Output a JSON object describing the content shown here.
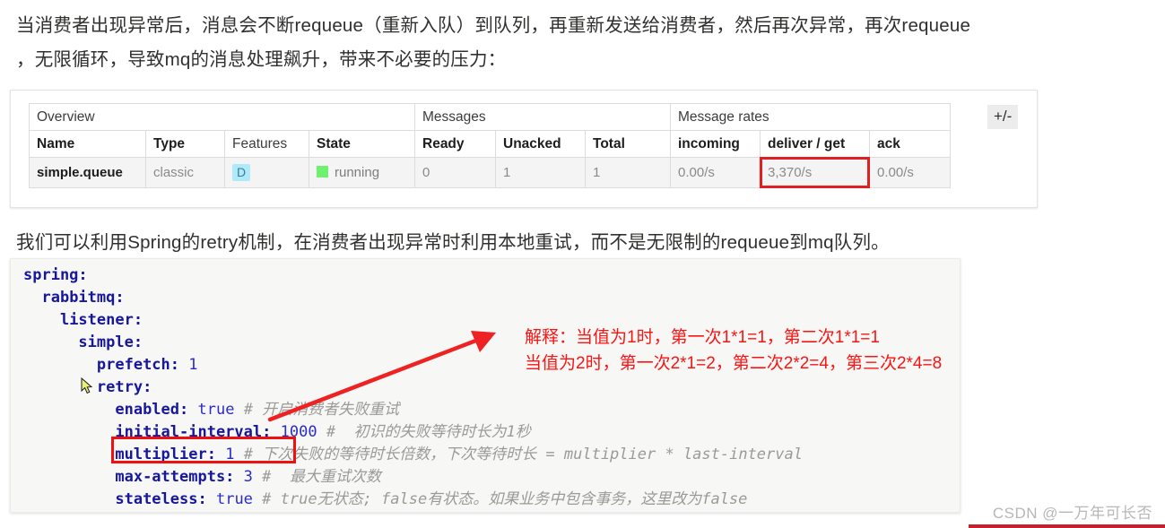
{
  "paragraphs": {
    "intro_line1": "当消费者出现异常后，消息会不断requeue（重新入队）到队列，再重新发送给消费者，然后再次异常，再次requeue",
    "intro_line2": "，无限循环，导致mq的消息处理飙升，带来不必要的压力：",
    "solution": "我们可以利用Spring的retry机制，在消费者出现异常时利用本地重试，而不是无限制的requeue到mq队列。"
  },
  "mq_table": {
    "group_headers": [
      "Overview",
      "Messages",
      "Message rates"
    ],
    "columns": [
      "Name",
      "Type",
      "Features",
      "State",
      "Ready",
      "Unacked",
      "Total",
      "incoming",
      "deliver / get",
      "ack"
    ],
    "rows": [
      {
        "name": "simple.queue",
        "type": "classic",
        "features": "D",
        "state": "running",
        "ready": "0",
        "unacked": "1",
        "total": "1",
        "incoming": "0.00/s",
        "deliver_get": "3,370/s",
        "ack": "0.00/s"
      }
    ],
    "toggle_label": "+/-",
    "highlight_color": "#e02020",
    "state_dot_color": "#6ff06f",
    "feature_badge_color": "#aeeafb"
  },
  "code": {
    "lines": [
      {
        "indent": 0,
        "key": "spring:",
        "value": "",
        "comment": ""
      },
      {
        "indent": 1,
        "key": "rabbitmq:",
        "value": "",
        "comment": ""
      },
      {
        "indent": 2,
        "key": "listener:",
        "value": "",
        "comment": ""
      },
      {
        "indent": 3,
        "key": "simple:",
        "value": "",
        "comment": ""
      },
      {
        "indent": 4,
        "key": "prefetch:",
        "value": "1",
        "comment": ""
      },
      {
        "indent": 4,
        "key": "retry:",
        "value": "",
        "comment": ""
      },
      {
        "indent": 5,
        "key": "enabled:",
        "value": "true",
        "comment": "# 开启消费者失败重试"
      },
      {
        "indent": 5,
        "key": "initial-interval:",
        "value": "1000",
        "comment": "#  初识的失败等待时长为1秒"
      },
      {
        "indent": 5,
        "key": "multiplier:",
        "value": "1",
        "comment": "# 下次失败的等待时长倍数，下次等待时长 = multiplier * last-interval"
      },
      {
        "indent": 5,
        "key": "max-attempts:",
        "value": "3",
        "comment": "#  最大重试次数"
      },
      {
        "indent": 5,
        "key": "stateless:",
        "value": "true",
        "comment": "# true无状态; false有状态。如果业务中包含事务，这里改为false"
      }
    ],
    "highlight_line_key": "multiplier",
    "highlight_color": "#f01010"
  },
  "annotation": {
    "line1": "解释：当值为1时，第一次1*1=1，第二次1*1=1",
    "line2": "当值为2时，第一次2*1=2，第二次2*2=4，第三次2*4=8",
    "color": "#fb1414"
  },
  "arrow": {
    "color": "#ee2222",
    "name": "red-pointer-arrow"
  },
  "watermark": {
    "text": "CSDN @一万年可长否",
    "bar_color": "#c6202a"
  }
}
